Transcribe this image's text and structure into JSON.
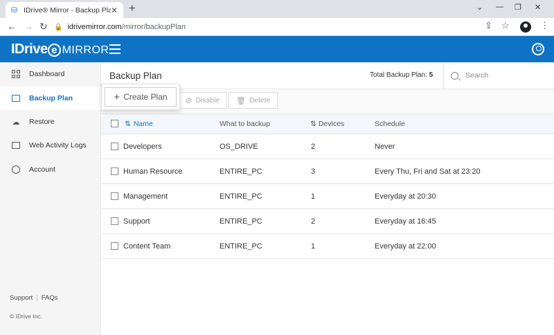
{
  "browser": {
    "tab_title": "IDrive® Mirror - Backup Plan",
    "url_host": "idrivemirror.com",
    "url_path": "/mirror/backupPlan"
  },
  "header": {
    "logo_text": "IDrive",
    "logo_e": "e",
    "logo_suffix": "MIRROR"
  },
  "sidebar": {
    "items": [
      {
        "label": "Dashboard",
        "icon": "dashboard-icon",
        "active": false
      },
      {
        "label": "Backup Plan",
        "icon": "monitor-icon",
        "active": true
      },
      {
        "label": "Restore",
        "icon": "cloud-restore-icon",
        "active": false
      },
      {
        "label": "Web Activity Logs",
        "icon": "logs-icon",
        "active": false
      },
      {
        "label": "Account",
        "icon": "account-icon",
        "active": false
      }
    ],
    "footer_links": [
      "Support",
      "FAQs"
    ],
    "copyright": "© IDrive Inc."
  },
  "main": {
    "title": "Backup Plan",
    "total_label": "Total Backup Plan:",
    "total_count": "5",
    "search_placeholder": "Search",
    "toolbar": {
      "create_label": "Create Plan",
      "disable_label": "Disable",
      "delete_label": "Delete"
    },
    "table": {
      "columns": [
        "Name",
        "What to backup",
        "Devices",
        "Schedule"
      ],
      "rows": [
        [
          "Developers",
          "OS_DRIVE",
          "2",
          "Never"
        ],
        [
          "Human Resource",
          "ENTIRE_PC",
          "3",
          "Every Thu, Fri and Sat at 23:20"
        ],
        [
          "Management",
          "ENTIRE_PC",
          "1",
          "Everyday at 20:30"
        ],
        [
          "Support",
          "ENTIRE_PC",
          "2",
          "Everyday at 16:45"
        ],
        [
          "Content Team",
          "ENTIRE_PC",
          "1",
          "Everyday at 22:00"
        ]
      ]
    }
  },
  "colors": {
    "brand": "#0f73c5",
    "sidebar_bg": "#f5f5f5",
    "table_header_bg": "#f3f6fa"
  }
}
